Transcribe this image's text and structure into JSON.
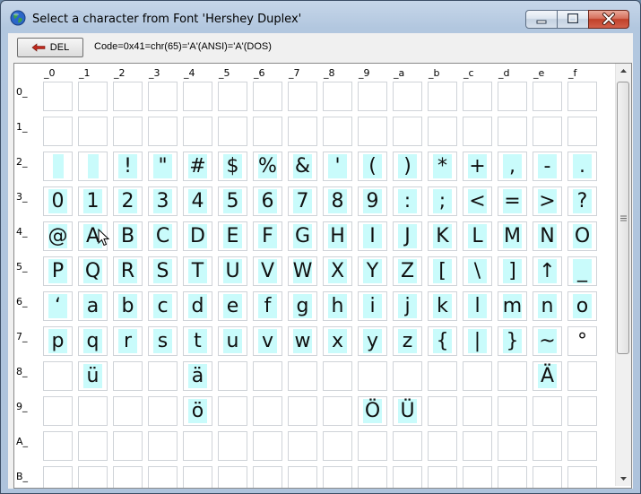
{
  "window": {
    "title": "Select a character from Font 'Hershey Duplex'"
  },
  "toolbar": {
    "del_label": "DEL",
    "code_text": "Code=0x41=chr(65)='A'(ANSI)='A'(DOS)"
  },
  "grid": {
    "columns": [
      "_0",
      "_1",
      "_2",
      "_3",
      "_4",
      "_5",
      "_6",
      "_7",
      "_8",
      "_9",
      "_a",
      "_b",
      "_c",
      "_d",
      "_e",
      "_f"
    ],
    "rows": [
      {
        "label": "0_",
        "chars": [
          "",
          "",
          "",
          "",
          "",
          "",
          "",
          "",
          "",
          "",
          "",
          "",
          "",
          "",
          "",
          ""
        ],
        "hl": [
          0,
          0,
          0,
          0,
          0,
          0,
          0,
          0,
          0,
          0,
          0,
          0,
          0,
          0,
          0,
          0
        ]
      },
      {
        "label": "1_",
        "chars": [
          "",
          "",
          "",
          "",
          "",
          "",
          "",
          "",
          "",
          "",
          "",
          "",
          "",
          "",
          "",
          ""
        ],
        "hl": [
          0,
          0,
          0,
          0,
          0,
          0,
          0,
          0,
          0,
          0,
          0,
          0,
          0,
          0,
          0,
          0
        ]
      },
      {
        "label": "2_",
        "chars": [
          "",
          " ",
          "!",
          "\"",
          "#",
          "$",
          "%",
          "&",
          "'",
          "(",
          ")",
          "*",
          "+",
          ",",
          "-",
          ".",
          "/"
        ],
        "hl": [
          1,
          1,
          1,
          1,
          1,
          1,
          1,
          1,
          1,
          1,
          1,
          1,
          1,
          1,
          1,
          1
        ]
      },
      {
        "label": "3_",
        "chars": [
          "0",
          "1",
          "2",
          "3",
          "4",
          "5",
          "6",
          "7",
          "8",
          "9",
          ":",
          ";",
          "<",
          "=",
          ">",
          "?"
        ],
        "hl": [
          1,
          1,
          1,
          1,
          1,
          1,
          1,
          1,
          1,
          1,
          1,
          1,
          1,
          1,
          1,
          1
        ]
      },
      {
        "label": "4_",
        "chars": [
          "@",
          "A",
          "B",
          "C",
          "D",
          "E",
          "F",
          "G",
          "H",
          "I",
          "J",
          "K",
          "L",
          "M",
          "N",
          "O"
        ],
        "hl": [
          1,
          1,
          1,
          1,
          1,
          1,
          1,
          1,
          1,
          1,
          1,
          1,
          1,
          1,
          1,
          1
        ]
      },
      {
        "label": "5_",
        "chars": [
          "P",
          "Q",
          "R",
          "S",
          "T",
          "U",
          "V",
          "W",
          "X",
          "Y",
          "Z",
          "[",
          "\\",
          "]",
          "↑",
          "_"
        ],
        "hl": [
          1,
          1,
          1,
          1,
          1,
          1,
          1,
          1,
          1,
          1,
          1,
          1,
          1,
          1,
          1,
          1
        ]
      },
      {
        "label": "6_",
        "chars": [
          "‘",
          "a",
          "b",
          "c",
          "d",
          "e",
          "f",
          "g",
          "h",
          "i",
          "j",
          "k",
          "l",
          "m",
          "n",
          "o"
        ],
        "hl": [
          1,
          1,
          1,
          1,
          1,
          1,
          1,
          1,
          1,
          1,
          1,
          1,
          1,
          1,
          1,
          1
        ]
      },
      {
        "label": "7_",
        "chars": [
          "p",
          "q",
          "r",
          "s",
          "t",
          "u",
          "v",
          "w",
          "x",
          "y",
          "z",
          "{",
          "|",
          "}",
          "~",
          "°"
        ],
        "hl": [
          1,
          1,
          1,
          1,
          1,
          1,
          1,
          1,
          1,
          1,
          1,
          1,
          1,
          1,
          1,
          0
        ]
      },
      {
        "label": "8_",
        "chars": [
          "",
          "ü",
          "",
          "",
          "ä",
          "",
          "",
          "",
          "",
          "",
          "",
          "",
          "",
          "",
          "Ä",
          ""
        ],
        "hl": [
          0,
          1,
          0,
          0,
          1,
          0,
          0,
          0,
          0,
          0,
          0,
          0,
          0,
          0,
          1,
          0
        ]
      },
      {
        "label": "9_",
        "chars": [
          "",
          "",
          "",
          "",
          "ö",
          "",
          "",
          "",
          "",
          "Ö",
          "Ü",
          "",
          "",
          "",
          "",
          ""
        ],
        "hl": [
          0,
          0,
          0,
          0,
          1,
          0,
          0,
          0,
          0,
          1,
          1,
          0,
          0,
          0,
          0,
          0
        ]
      },
      {
        "label": "A_",
        "chars": [
          "",
          "",
          "",
          "",
          "",
          "",
          "",
          "",
          "",
          "",
          "",
          "",
          "",
          "",
          "",
          ""
        ],
        "hl": [
          0,
          0,
          0,
          0,
          0,
          0,
          0,
          0,
          0,
          0,
          0,
          0,
          0,
          0,
          0,
          0
        ]
      },
      {
        "label": "B_",
        "chars": [
          "",
          "",
          "",
          "",
          "",
          "",
          "",
          "",
          "",
          "",
          "",
          "",
          "",
          "",
          "",
          ""
        ],
        "hl": [
          0,
          0,
          0,
          0,
          0,
          0,
          0,
          0,
          0,
          0,
          0,
          0,
          0,
          0,
          0,
          0
        ]
      }
    ]
  },
  "icons": {
    "app": "globe-icon",
    "minimize": "minimize-icon",
    "maximize": "maximize-icon",
    "close": "close-icon",
    "del": "left-arrow-icon"
  },
  "colors": {
    "highlight": "#c9fbfb",
    "close_button": "#c0412a",
    "del_arrow": "#c0281c"
  }
}
